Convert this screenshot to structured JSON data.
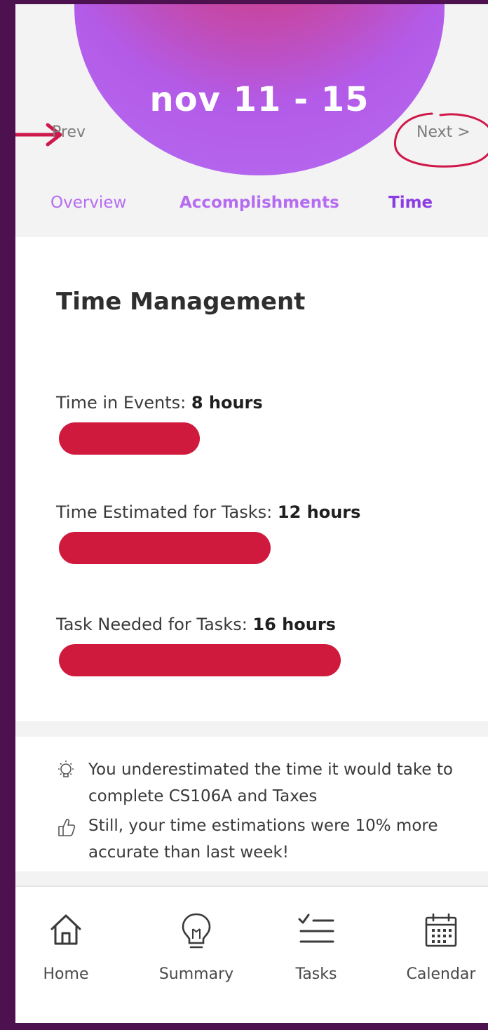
{
  "header": {
    "week_range": "nov 11 - 15",
    "prev_label": "Prev",
    "next_label": "Next >",
    "tabs": [
      {
        "label": "Overview"
      },
      {
        "label": "Accomplishments"
      },
      {
        "label": "Time"
      }
    ],
    "active_tab": "Time"
  },
  "time_management": {
    "title": "Time Management",
    "metrics": [
      {
        "label": "Time in Events: ",
        "value": "8 hours",
        "hours": 8
      },
      {
        "label": "Time Estimated for Tasks: ",
        "value": "12 hours",
        "hours": 12
      },
      {
        "label": "Task Needed for Tasks: ",
        "value": "16 hours",
        "hours": 16
      }
    ],
    "bar_color": "#cf1a3d"
  },
  "insights": [
    {
      "icon": "lightbulb-icon",
      "text": "You underestimated the time it would take to complete CS106A and Taxes"
    },
    {
      "icon": "thumbs-up-icon",
      "text": "Still, your time estimations were 10% more accurate than last week!"
    }
  ],
  "bottom_nav": [
    {
      "icon": "home-icon",
      "label": "Home"
    },
    {
      "icon": "lightbulb-icon",
      "label": "Summary"
    },
    {
      "icon": "checklist-icon",
      "label": "Tasks"
    },
    {
      "icon": "calendar-icon",
      "label": "Calendar"
    }
  ],
  "colors": {
    "accent_purple": "#b56cf1",
    "active_tab": "#8b3de3",
    "bar_red": "#cf1a3d",
    "annotation_red": "#d0174a",
    "background": "#4e1150"
  }
}
